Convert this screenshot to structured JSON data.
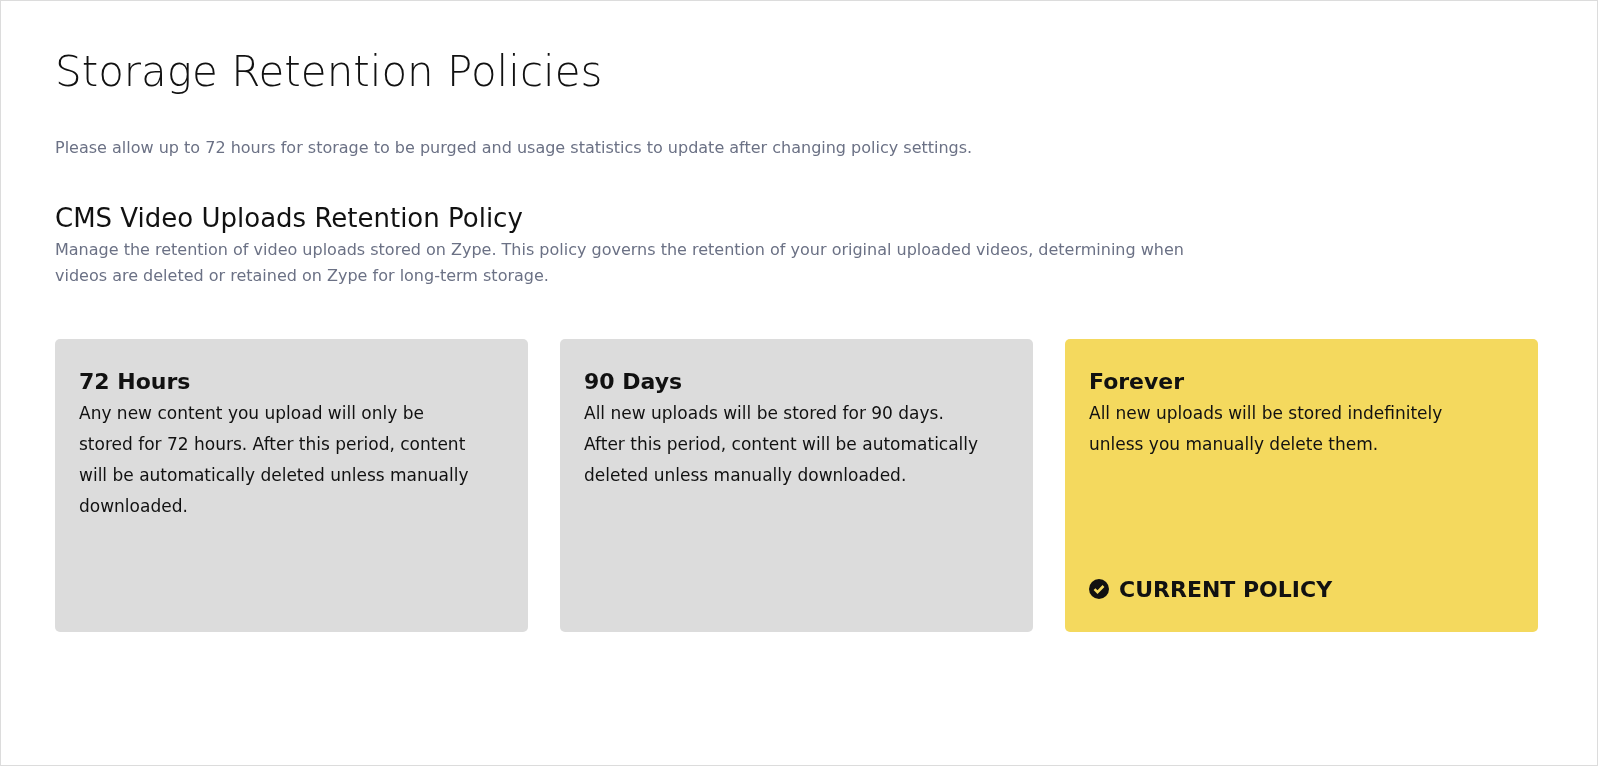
{
  "title": "Storage Retention Policies",
  "notice": "Please allow up to 72 hours for storage to be purged and usage statistics to update after changing policy settings.",
  "section": {
    "heading": "CMS Video Uploads Retention Policy",
    "description": "Manage the retention of video uploads stored on Zype. This policy governs the retention of your original uploaded videos, determining when videos are deleted or retained on Zype for long-term storage.",
    "current_label": "CURRENT POLICY",
    "policies": [
      {
        "name": "72 Hours",
        "text": "Any new content you upload will only be stored for 72 hours. After this period, content will be automatically deleted unless manually downloaded.",
        "selected": false
      },
      {
        "name": "90 Days",
        "text": "All new uploads will be stored for 90 days. After this period, content will be automatically deleted unless manually downloaded.",
        "selected": false
      },
      {
        "name": "Forever",
        "text": "All new uploads will be stored indefinitely unless you manually delete them.",
        "selected": true
      }
    ]
  }
}
